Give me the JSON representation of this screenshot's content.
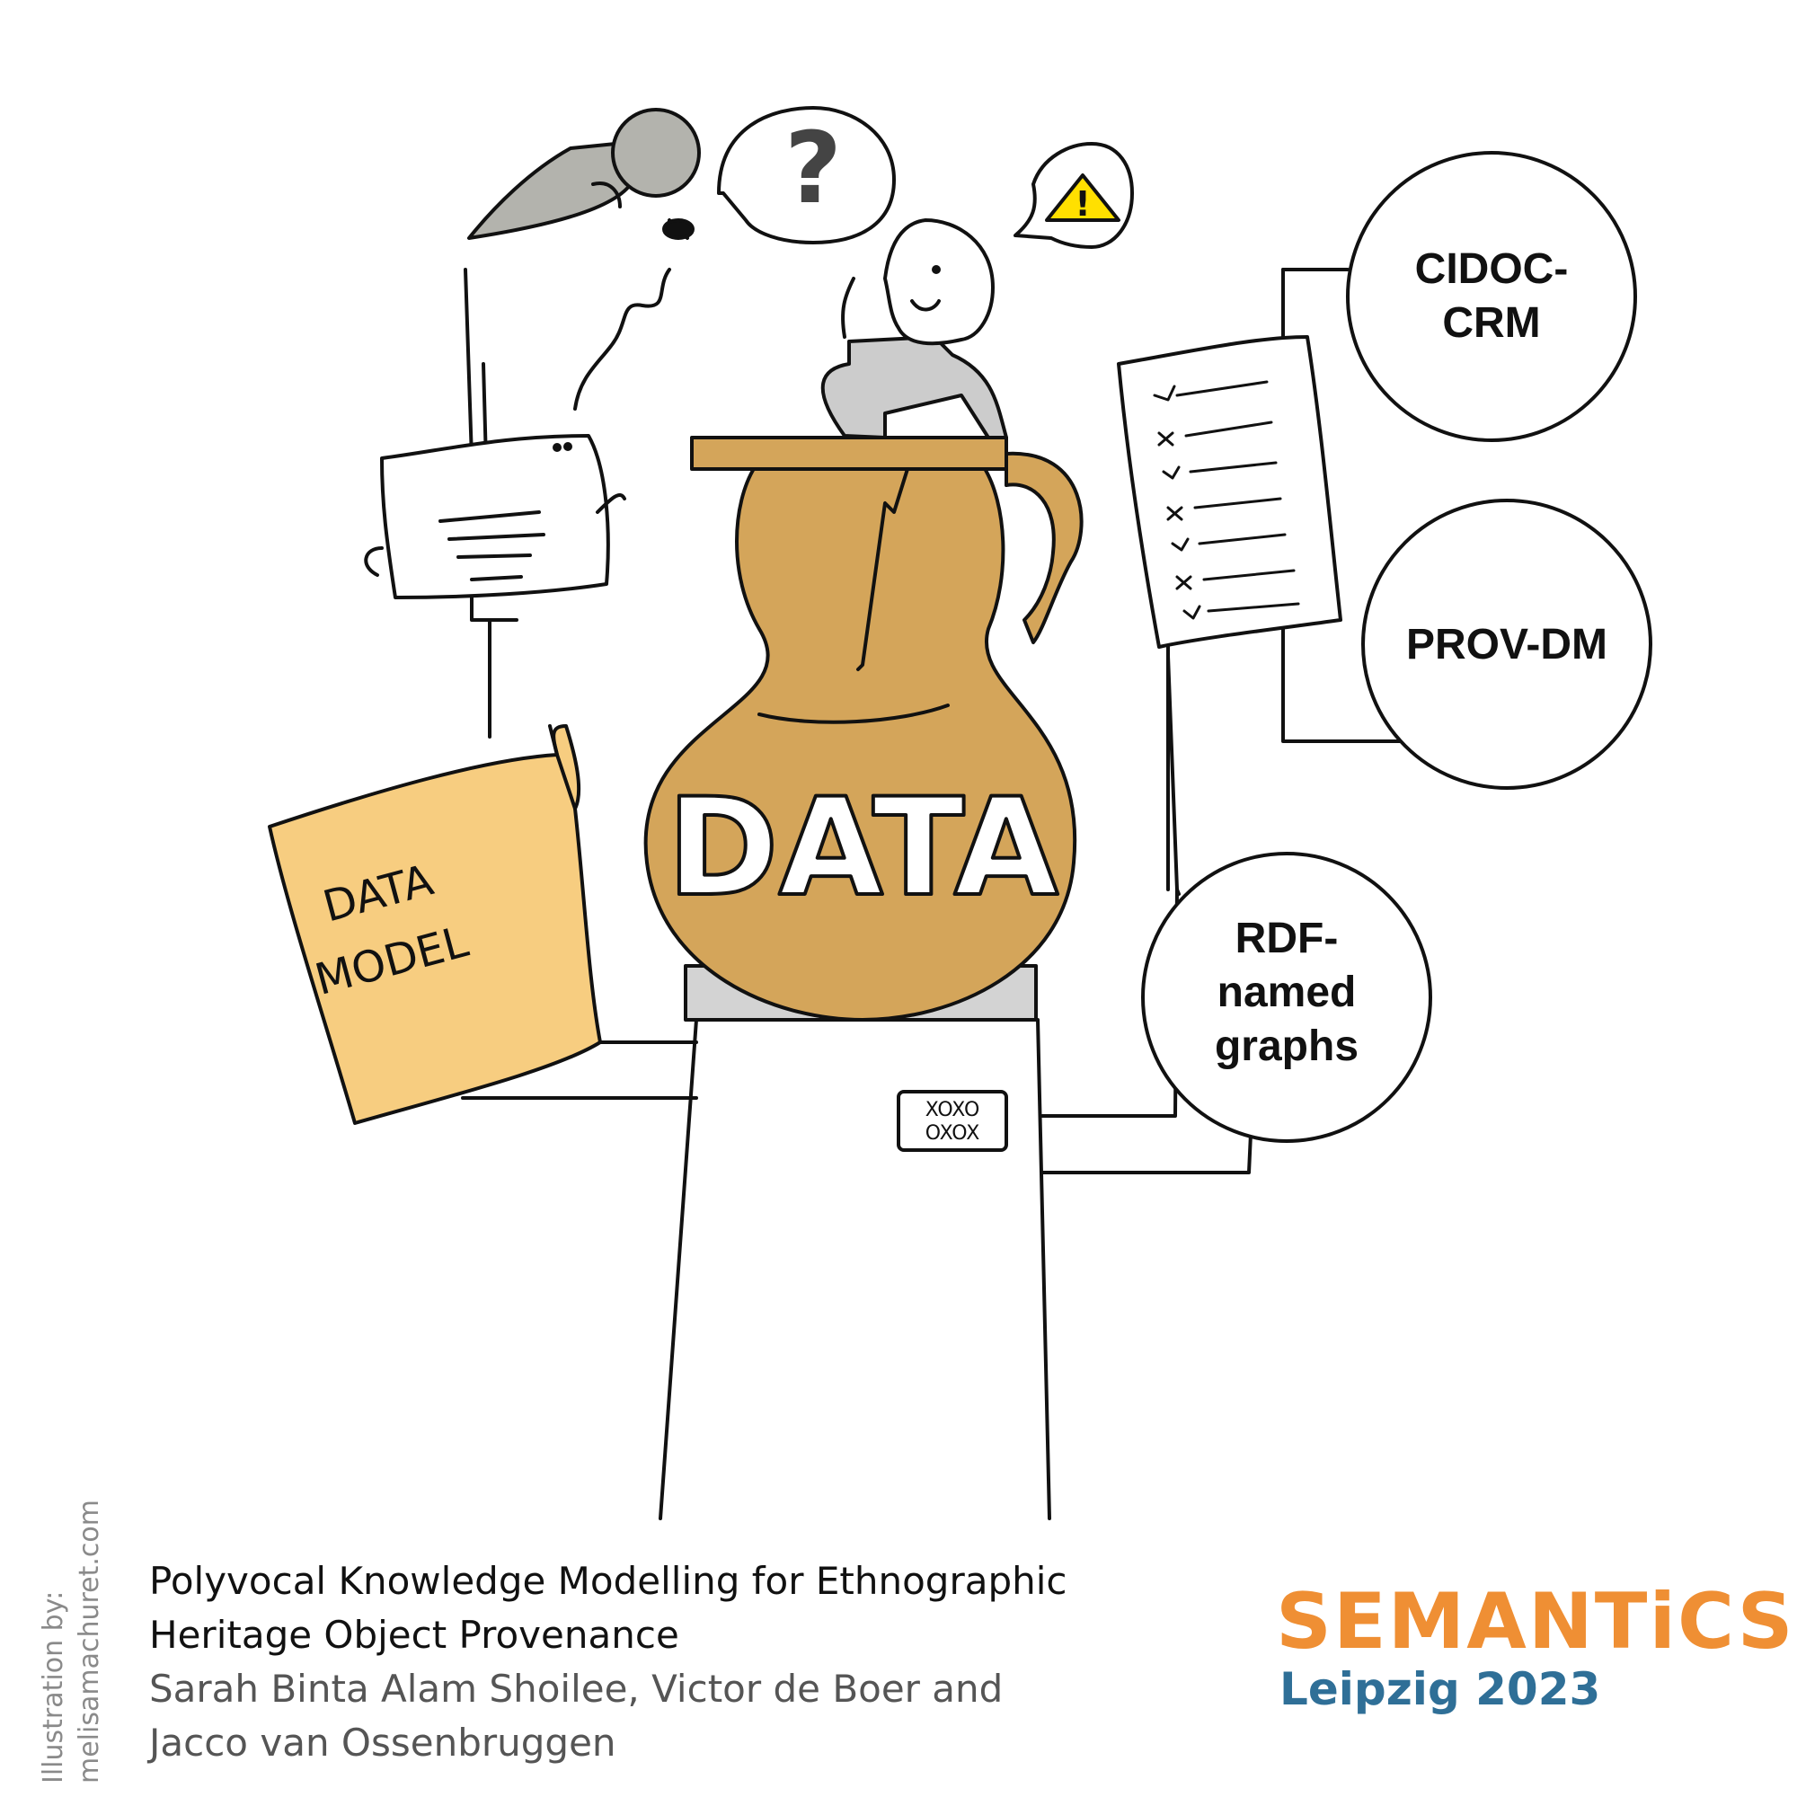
{
  "diagram": {
    "center_label": "DATA",
    "folder_label": "DATA MODEL",
    "circles": {
      "cidoc": "CIDOC-CRM",
      "prov": "PROV-DM",
      "rdf": "RDF-named graphs"
    },
    "bubbles": {
      "question": "?",
      "warning": "!"
    },
    "label_tag": "XOXO OXOX",
    "checklist": [
      "✓",
      "✗",
      "✓",
      "✗",
      "✓",
      "✗",
      "✓"
    ]
  },
  "caption": {
    "title_line1": "Polyvocal Knowledge Modelling for Ethnographic",
    "title_line2": "Heritage Object Provenance",
    "authors_line1": "Sarah Binta Alam Shoilee, Victor de Boer and",
    "authors_line2": "Jacco van Ossenbruggen"
  },
  "credit": {
    "line1": "Illustration by:",
    "line2": "melisamachuret.com"
  },
  "logo": {
    "name": "SEMANTiCS",
    "event": "Leipzig 2023"
  },
  "colors": {
    "jug": "#d4a55a",
    "folder": "#f7cd80",
    "plinth_top": "#d3d3d3",
    "person": "#cccccc",
    "lamp": "#b3b3ad",
    "warning": "#ffe000",
    "logo_orange": "#ef8f34",
    "logo_blue": "#2f6f97"
  }
}
